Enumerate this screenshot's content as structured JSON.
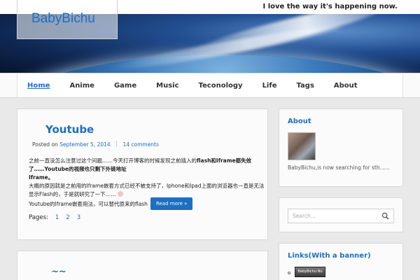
{
  "site": {
    "logo": "BabyBichu",
    "tagline": "I love the way it's happening now."
  },
  "nav": {
    "items": [
      {
        "label": "Home",
        "active": true
      },
      {
        "label": "Anime",
        "active": false
      },
      {
        "label": "Game",
        "active": false
      },
      {
        "label": "Music",
        "active": false
      },
      {
        "label": "Teconology",
        "active": false
      },
      {
        "label": "Life",
        "active": false
      },
      {
        "label": "Tags",
        "active": false
      },
      {
        "label": "About",
        "active": false
      }
    ]
  },
  "posts": [
    {
      "title": "Youtube",
      "posted_on_label": "Posted on",
      "date": "September 5, 2014",
      "comments": "14 comments",
      "excerpt_line1_a": "之前一直没怎么注意过这个问题……今天打开博客的时候发现之前插入的",
      "excerpt_line1_b": "flash和Iframe都失效了……Youtube的视频也只剩下外链地址",
      "excerpt_line2": "Iframe。",
      "excerpt_line3": "大概的原因就是之前用的Iframe嵌套方式已经不被支持了，Iphone和Ipad上面的浏览器也一直是无法显示Flash的，于是就研究了一下……",
      "excerpt_tail": "Youtube的Iframe嵌套用法，可以替代原来的flash",
      "read_more": "Read more »",
      "pages_label": "Pages:",
      "pages": [
        "1",
        "2",
        "3"
      ]
    },
    {
      "title": "~~"
    }
  ],
  "sidebar": {
    "about": {
      "title": "About",
      "text": "BabyBichu,is now searching for sth......"
    },
    "search": {
      "placeholder": "Search..."
    },
    "links": {
      "title": "Links(With a banner)",
      "banner_text": "BabyBichu.Nu"
    }
  },
  "colors": {
    "accent": "#1e6fc0",
    "background": "#e9e9e9"
  }
}
